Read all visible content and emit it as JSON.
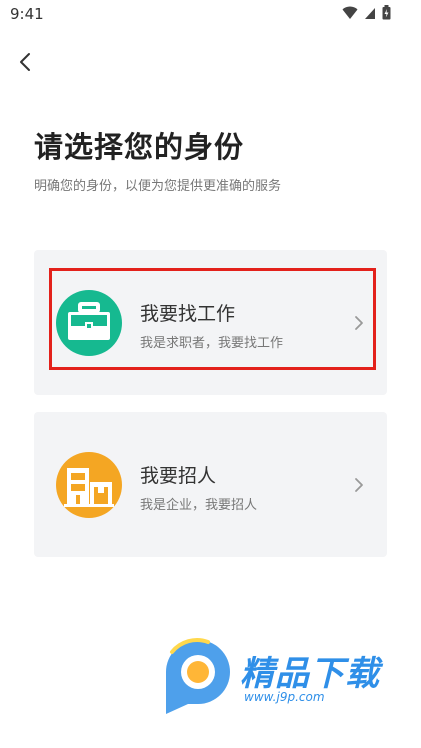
{
  "status_bar": {
    "time": "9:41",
    "icons": [
      "wifi-icon",
      "signal-icon",
      "battery-icon"
    ]
  },
  "header": {
    "back_icon": "chevron-left-icon",
    "title": "请选择您的身份",
    "subtitle": "明确您的身份，以便为您提供更准确的服务"
  },
  "roles": [
    {
      "title": "我要找工作",
      "description": "我是求职者，我要找工作",
      "icon": "briefcase-icon",
      "icon_color": "#16b990",
      "highlighted": true
    },
    {
      "title": "我要招人",
      "description": "我是企业，我要招人",
      "icon": "building-icon",
      "icon_color": "#f4a623",
      "highlighted": false
    }
  ],
  "watermark": {
    "text": "精品下载",
    "url": "www.j9p.com",
    "color": "#2f8fe8"
  },
  "colors": {
    "highlight_border": "#e3211b",
    "card_background": "#f3f4f6"
  }
}
